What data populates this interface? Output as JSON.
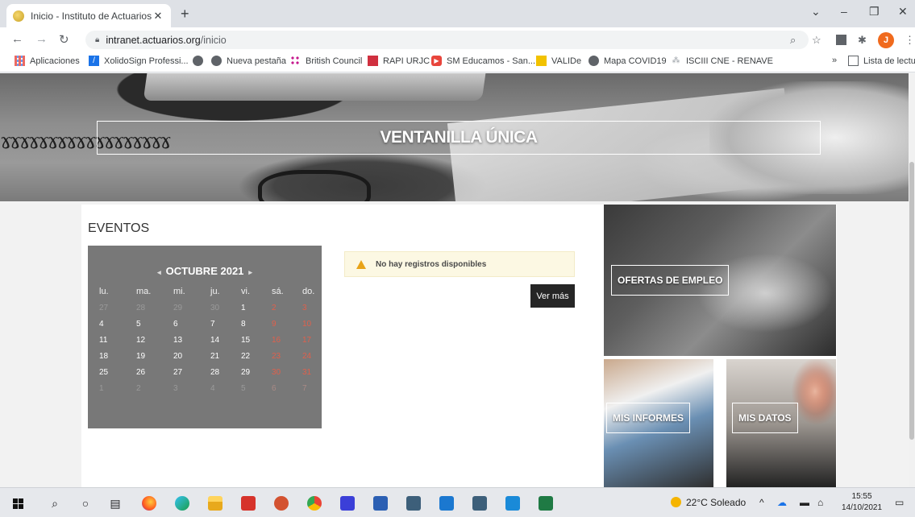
{
  "browser": {
    "tab_title": "Inicio - Instituto de Actuarios Esp",
    "tab_close": "✕",
    "new_tab": "+",
    "window_controls": {
      "dropdown": "⌄",
      "minimize": "–",
      "restore": "❐",
      "close": "✕"
    },
    "url_host": "intranet.actuarios.org",
    "url_path": "/inicio",
    "profile_initial": "J"
  },
  "bookmarks": {
    "items": [
      "Aplicaciones",
      "XolidoSign Professi...",
      "",
      "Nueva pestaña",
      "British Council",
      "RAPI URJC",
      "SM Educamos - San...",
      "VALIDe",
      "Mapa COVID19",
      "ISCIII CNE - RENAVE"
    ],
    "overflow": "»",
    "reading_list": "Lista de lectura"
  },
  "hero": {
    "title": "VENTANILLA ÚNICA"
  },
  "events": {
    "title": "EVENTOS",
    "calendar": {
      "month": "OCTUBRE 2021",
      "prev": "◂",
      "next": "▸",
      "weekdays": [
        "lu.",
        "ma.",
        "mi.",
        "ju.",
        "vi.",
        "sá.",
        "do."
      ],
      "weeks": [
        [
          "27",
          "28",
          "29",
          "30",
          "1",
          "2",
          "3"
        ],
        [
          "4",
          "5",
          "6",
          "7",
          "8",
          "9",
          "10"
        ],
        [
          "11",
          "12",
          "13",
          "14",
          "15",
          "16",
          "17"
        ],
        [
          "18",
          "19",
          "20",
          "21",
          "22",
          "23",
          "24"
        ],
        [
          "25",
          "26",
          "27",
          "28",
          "29",
          "30",
          "31"
        ],
        [
          "1",
          "2",
          "3",
          "4",
          "5",
          "6",
          "7"
        ]
      ]
    },
    "alert_text": "No hay registros disponibles",
    "more_button": "Ver más"
  },
  "tiles": {
    "ofertas": "OFERTAS DE EMPLEO",
    "informes": "MIS INFORMES",
    "datos": "MIS DATOS"
  },
  "taskbar": {
    "weather": "22°C Soleado",
    "time": "15:55",
    "date": "14/10/2021"
  }
}
